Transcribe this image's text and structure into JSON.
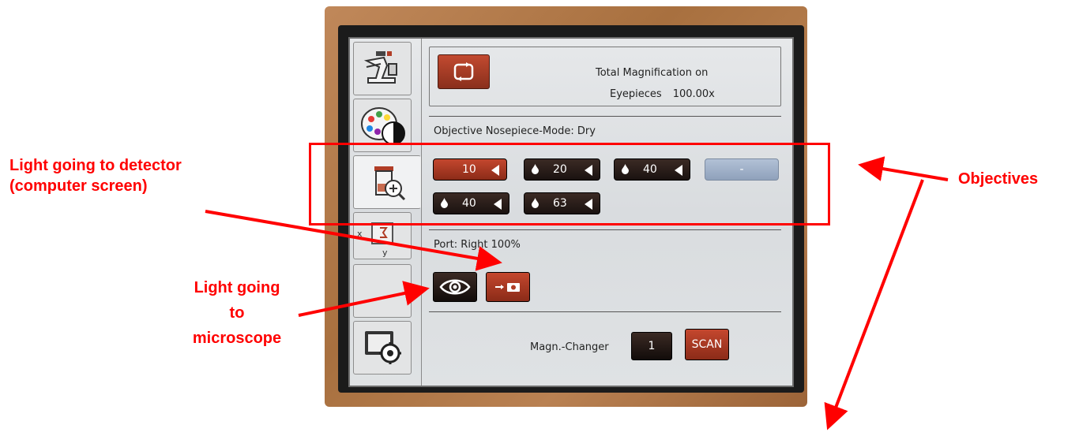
{
  "screen": {
    "magnification": {
      "line1": "Total Magnification on",
      "label": "Eyepieces",
      "value": "100.00x"
    },
    "nosepiece_label": "Objective Nosepiece-Mode: Dry",
    "objectives": [
      {
        "value": "10",
        "active": true,
        "drop": false
      },
      {
        "value": "20",
        "active": false,
        "drop": true
      },
      {
        "value": "40",
        "active": false,
        "drop": true
      },
      {
        "value": "-",
        "active": false,
        "empty": true
      },
      {
        "value": "40",
        "active": false,
        "drop": true
      },
      {
        "value": "63",
        "active": false,
        "drop": true
      }
    ],
    "port_label": "Port: Right 100%",
    "changer_label": "Magn.-Changer",
    "changer_value": "1",
    "scan_label": "SCAN",
    "sidebar": {
      "xy_x": "x",
      "xy_y": "y"
    }
  },
  "annotations": {
    "detector_line1": "Light going to detector",
    "detector_line2": "(computer screen)",
    "microscope_line1": "Light going",
    "microscope_line2": "to",
    "microscope_line3": "microscope",
    "objectives": "Objectives"
  },
  "colors": {
    "annotation": "#ff0000",
    "active_button": "#b03d26",
    "dark_button": "#2a1d19",
    "bezel": "#b07a4a"
  },
  "icons": [
    "microscope-icon",
    "color-palette-icon",
    "objective-zoom-icon",
    "xy-stage-icon",
    "settings-icon",
    "swap-icon",
    "drop-icon",
    "eye-icon",
    "camera-icon"
  ]
}
